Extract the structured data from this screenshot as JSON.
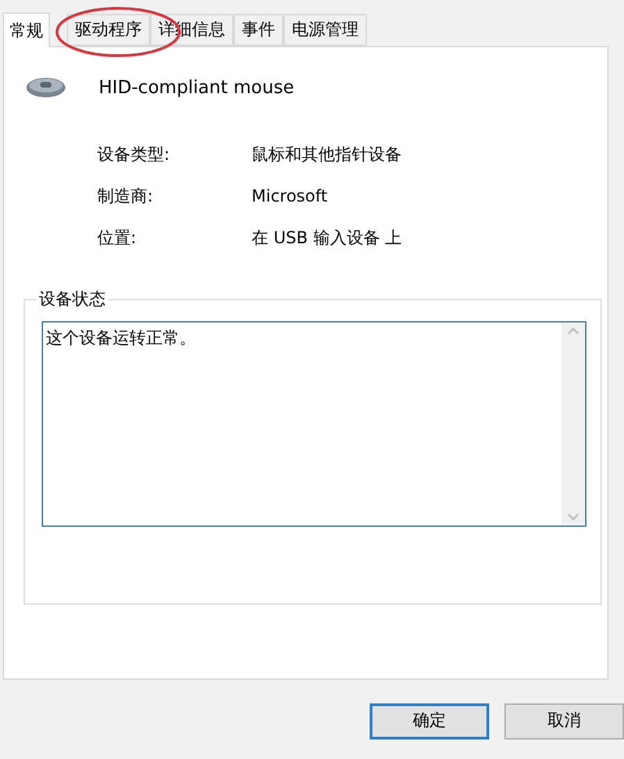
{
  "tabs": [
    {
      "label": "常规",
      "selected": true
    },
    {
      "label": "驱动程序",
      "selected": false
    },
    {
      "label": "详细信息",
      "selected": false
    },
    {
      "label": "事件",
      "selected": false
    },
    {
      "label": "电源管理",
      "selected": false
    }
  ],
  "device": {
    "name": "HID-compliant mouse"
  },
  "properties": [
    {
      "label": "设备类型:",
      "value": "鼠标和其他指针设备"
    },
    {
      "label": "制造商:",
      "value": "Microsoft"
    },
    {
      "label": "位置:",
      "value": "在 USB 输入设备 上"
    }
  ],
  "status": {
    "title": "设备状态",
    "text": "这个设备运转正常。"
  },
  "buttons": [
    {
      "label": "确定",
      "default": true
    },
    {
      "label": "取消",
      "default": false
    }
  ]
}
